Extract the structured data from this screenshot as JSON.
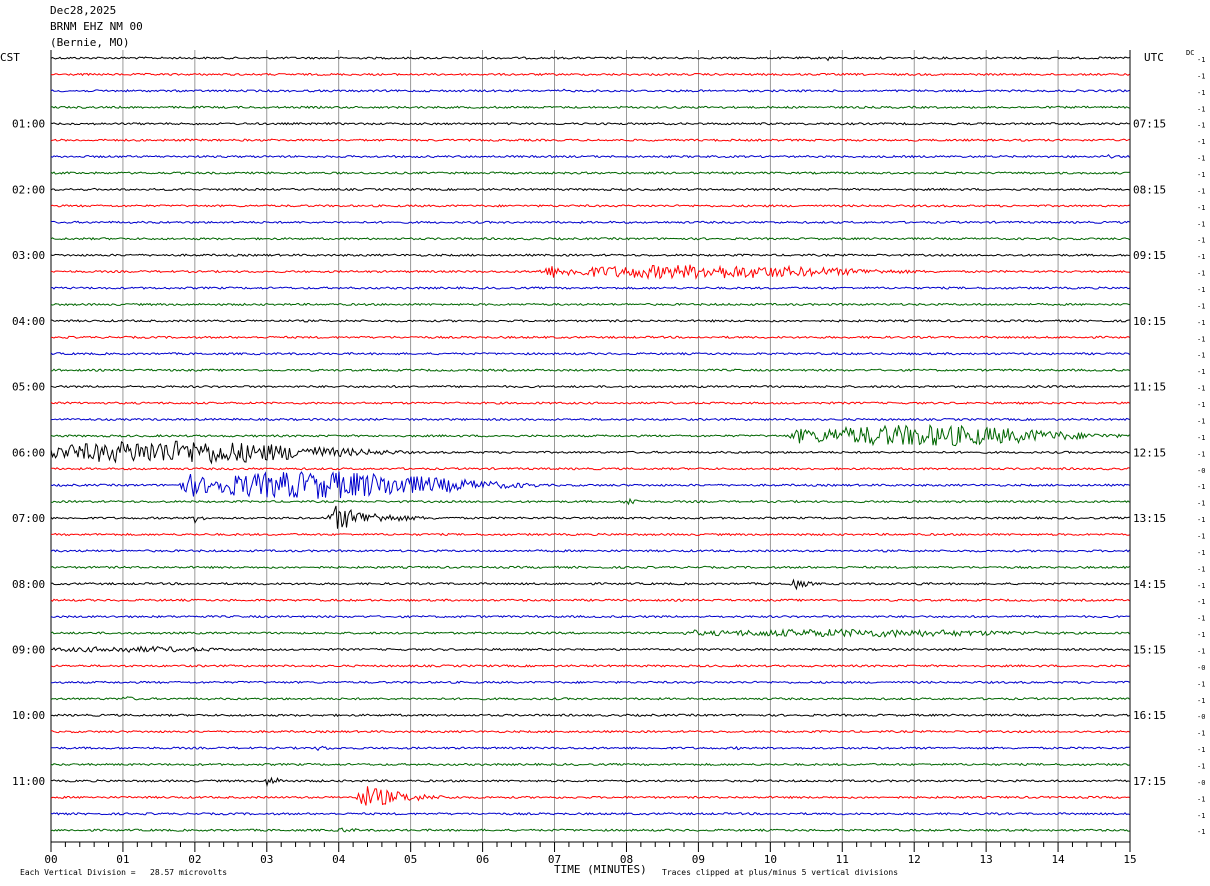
{
  "header": {
    "date": "Dec28,2025",
    "station": "BRNM EHZ NM 00",
    "location": "(Bernie, MO)"
  },
  "left_tz": "CST",
  "right_tz": "UTC",
  "dc_label": "DC",
  "footer": {
    "scale_text": "Each Vertical Division =   28.57 microvolts",
    "xlabel": "TIME (MINUTES)",
    "clip_text": "Traces clipped at plus/minus 5 vertical divisions"
  },
  "chart_data": {
    "type": "line",
    "title": "BRNM EHZ NM 00",
    "xlabel": "TIME (MINUTES)",
    "ylabel": "",
    "xlim": [
      0,
      15
    ],
    "x_ticks": [
      "00",
      "01",
      "02",
      "03",
      "04",
      "05",
      "06",
      "07",
      "08",
      "09",
      "10",
      "11",
      "12",
      "13",
      "14",
      "15"
    ],
    "left_hour_labels": [
      "01:00",
      "02:00",
      "03:00",
      "04:00",
      "05:00",
      "06:00",
      "07:00",
      "08:00",
      "09:00",
      "10:00",
      "11:00"
    ],
    "right_hour_labels": [
      "07:15",
      "08:15",
      "09:15",
      "10:15",
      "11:15",
      "12:15",
      "13:15",
      "14:15",
      "15:15",
      "16:15",
      "17:15"
    ],
    "trace_minutes": 15,
    "trace_count": 48,
    "trace_colors": [
      "#000000",
      "#ff0000",
      "#0000cc",
      "#006600"
    ],
    "dc_offsets": [
      "-1",
      "-1",
      "-1",
      "-1",
      "-1",
      "-1",
      "-1",
      "-1",
      "-1",
      "-1",
      "-1",
      "-1",
      "-1",
      "-1",
      "-1",
      "-1",
      "-1",
      "-1",
      "-1",
      "-1",
      "-1",
      "-1",
      "-1",
      "-1",
      "-1",
      "-0",
      "-1",
      "-1",
      "-1",
      "-1",
      "-1",
      "-1",
      "-1",
      "-1",
      "-1",
      "-1",
      "-1",
      "-0",
      "-1",
      "-1",
      "-0",
      "-1",
      "-1",
      "-1",
      "-0",
      "-1",
      "-1",
      "-1"
    ],
    "events": [
      {
        "trace": 0,
        "minute": 10.8,
        "amplitude": 3,
        "duration": 0.3
      },
      {
        "trace": 2,
        "minute": 7.1,
        "amplitude": 2,
        "duration": 0.4
      },
      {
        "trace": 6,
        "minute": 14.7,
        "amplitude": 2,
        "duration": 0.3
      },
      {
        "trace": 13,
        "minute": 7.0,
        "amplitude": 7,
        "duration": 5.5
      },
      {
        "trace": 23,
        "minute": 10.5,
        "amplitude": 11,
        "duration": 4.5
      },
      {
        "trace": 24,
        "minute": 0.0,
        "amplitude": 12,
        "duration": 5.0
      },
      {
        "trace": 26,
        "minute": 2.0,
        "amplitude": 14,
        "duration": 4.8
      },
      {
        "trace": 27,
        "minute": 8.0,
        "amplitude": 6,
        "duration": 0.4
      },
      {
        "trace": 28,
        "minute": 2.0,
        "amplitude": 5,
        "duration": 0.4
      },
      {
        "trace": 28,
        "minute": 3.9,
        "amplitude": 14,
        "duration": 1.5
      },
      {
        "trace": 32,
        "minute": 10.3,
        "amplitude": 7,
        "duration": 0.5
      },
      {
        "trace": 32,
        "minute": 12.0,
        "amplitude": 3,
        "duration": 0.4
      },
      {
        "trace": 33,
        "minute": 5.9,
        "amplitude": 2,
        "duration": 0.5
      },
      {
        "trace": 35,
        "minute": 9.0,
        "amplitude": 4,
        "duration": 6.0
      },
      {
        "trace": 36,
        "minute": 0.0,
        "amplitude": 3,
        "duration": 3.2
      },
      {
        "trace": 39,
        "minute": 1.0,
        "amplitude": 3,
        "duration": 0.6
      },
      {
        "trace": 42,
        "minute": 3.7,
        "amplitude": 3,
        "duration": 0.6
      },
      {
        "trace": 42,
        "minute": 9.5,
        "amplitude": 2,
        "duration": 0.5
      },
      {
        "trace": 44,
        "minute": 3.0,
        "amplitude": 6,
        "duration": 0.5
      },
      {
        "trace": 45,
        "minute": 4.3,
        "amplitude": 14,
        "duration": 1.4
      },
      {
        "trace": 47,
        "minute": 4.0,
        "amplitude": 3,
        "duration": 0.8
      }
    ]
  }
}
